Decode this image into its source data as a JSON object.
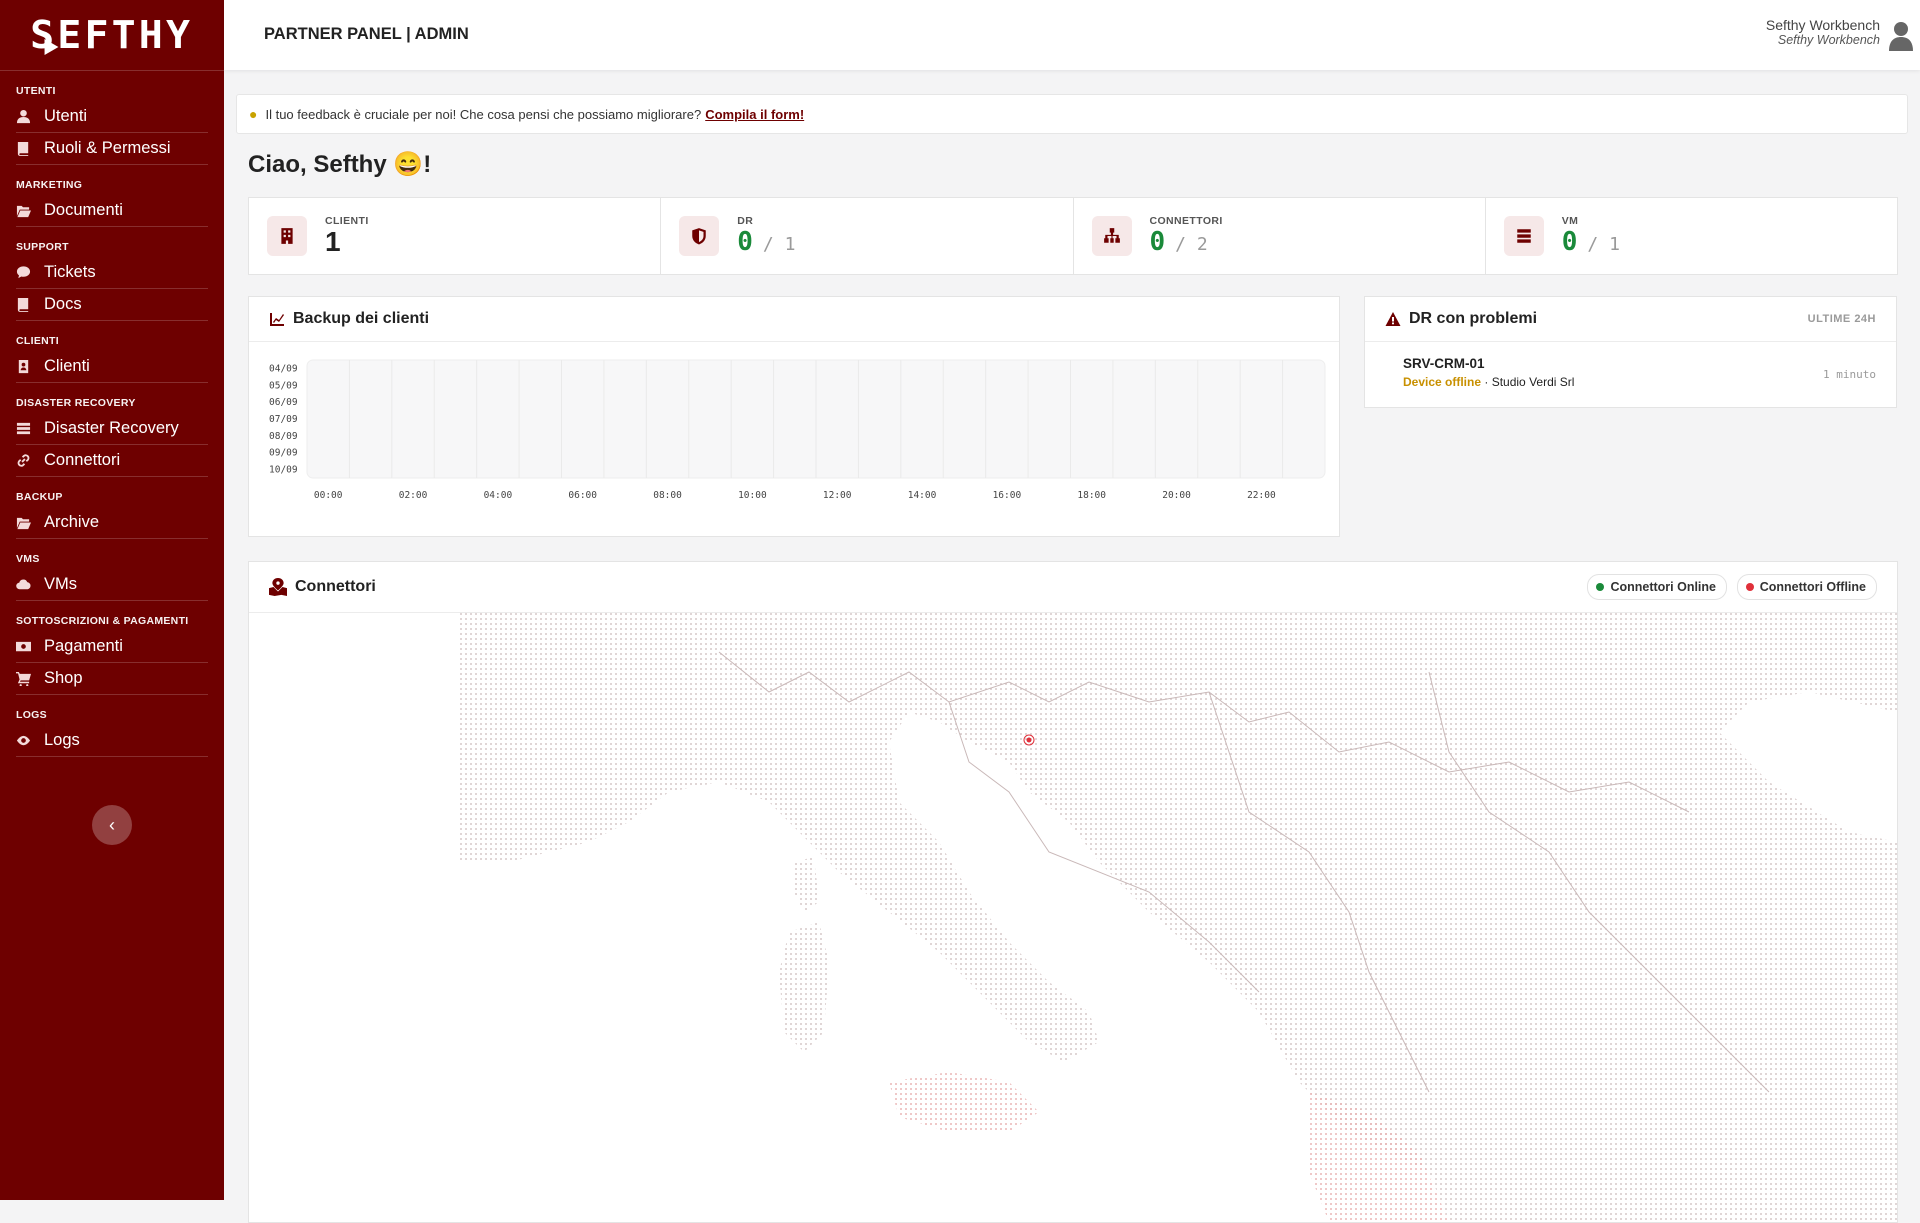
{
  "brand": {
    "logo_text": "SEFTHY"
  },
  "sidebar": {
    "sections": [
      {
        "heading": "UTENTI",
        "items": [
          {
            "label": "Utenti",
            "icon": "user-icon"
          },
          {
            "label": "Ruoli & Permessi",
            "icon": "book-icon"
          }
        ]
      },
      {
        "heading": "MARKETING",
        "items": [
          {
            "label": "Documenti",
            "icon": "folder-open-icon"
          }
        ]
      },
      {
        "heading": "SUPPORT",
        "items": [
          {
            "label": "Tickets",
            "icon": "chat-icon"
          },
          {
            "label": "Docs",
            "icon": "book-icon"
          }
        ]
      },
      {
        "heading": "CLIENTI",
        "items": [
          {
            "label": "Clienti",
            "icon": "address-book-icon"
          }
        ]
      },
      {
        "heading": "DISASTER RECOVERY",
        "items": [
          {
            "label": "Disaster Recovery",
            "icon": "server-icon"
          },
          {
            "label": "Connettori",
            "icon": "link-icon"
          }
        ]
      },
      {
        "heading": "BACKUP",
        "items": [
          {
            "label": "Archive",
            "icon": "folder-open-icon"
          }
        ]
      },
      {
        "heading": "VMS",
        "items": [
          {
            "label": "VMs",
            "icon": "cloud-icon"
          }
        ]
      },
      {
        "heading": "SOTTOSCRIZIONI & PAGAMENTI",
        "items": [
          {
            "label": "Pagamenti",
            "icon": "money-icon"
          },
          {
            "label": "Shop",
            "icon": "cart-icon"
          }
        ]
      },
      {
        "heading": "LOGS",
        "items": [
          {
            "label": "Logs",
            "icon": "eye-icon"
          }
        ]
      }
    ],
    "collapse_label": "‹"
  },
  "header": {
    "title": "PARTNER PANEL | ADMIN",
    "user_name": "Sefthy Workbench",
    "user_org": "Sefthy Workbench"
  },
  "feedback": {
    "text": "Il tuo feedback è cruciale per noi! Che cosa pensi che possiamo migliorare?",
    "link": "Compila il form!"
  },
  "greeting": "Ciao, Sefthy 😄!",
  "stats": [
    {
      "label": "CLIENTI",
      "value": "1",
      "total": "",
      "icon": "building-icon"
    },
    {
      "label": "DR",
      "value": "0",
      "total": "/ 1",
      "icon": "shield-icon"
    },
    {
      "label": "CONNETTORI",
      "value": "0",
      "total": "/ 2",
      "icon": "network-icon"
    },
    {
      "label": "VM",
      "value": "0",
      "total": "/ 1",
      "icon": "server-icon"
    }
  ],
  "backup_card": {
    "title": "Backup dei clienti"
  },
  "chart_data": {
    "type": "heatmap",
    "title": "Backup dei clienti",
    "y_categories": [
      "04/09",
      "05/09",
      "06/09",
      "07/09",
      "08/09",
      "09/09",
      "10/09"
    ],
    "x_categories": [
      "00:00",
      "02:00",
      "04:00",
      "06:00",
      "08:00",
      "10:00",
      "12:00",
      "14:00",
      "16:00",
      "18:00",
      "20:00",
      "22:00"
    ],
    "values": []
  },
  "dr_card": {
    "title": "DR con problemi",
    "badge": "ULTIME 24H",
    "items": [
      {
        "name": "SRV-CRM-01",
        "status": "Device offline",
        "separator": " · ",
        "client": "Studio Verdi Srl",
        "time": "1 minuto"
      }
    ]
  },
  "connectors_card": {
    "title": "Connettori",
    "legend_online": "Connettori Online",
    "legend_offline": "Connettori Offline"
  },
  "colors": {
    "brand": "#6e0000",
    "online": "#1a8a3a",
    "offline": "#e0303a",
    "warning": "#c89000"
  }
}
